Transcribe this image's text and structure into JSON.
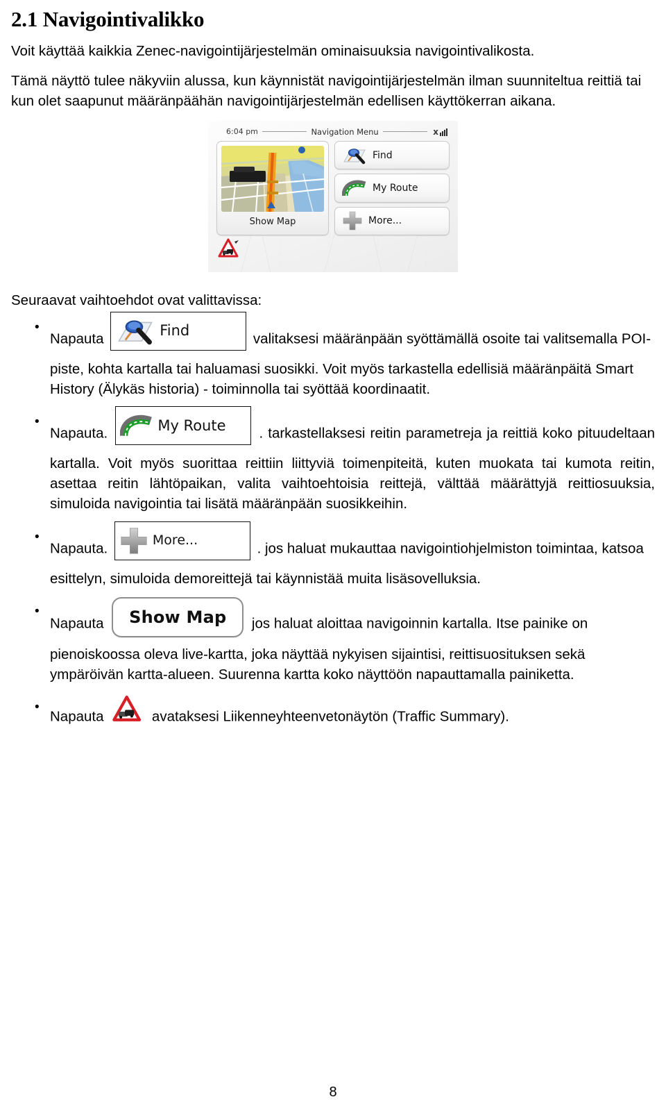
{
  "document": {
    "language": "fi",
    "page_number": "8"
  },
  "section": {
    "number": "2.1",
    "title": "2.1 Navigointivalikko",
    "intro_paragraph_1": "Voit käyttää kaikkia Zenec-navigointijärjestelmän ominaisuuksia navigointivalikosta.",
    "intro_paragraph_2": "Tämä näyttö tulee näkyviin alussa, kun käynnistät navigointijärjestelmän ilman suunniteltua reittiä tai kun olet saapunut määränpäähän navigointijärjestelmän edellisen käyttökerran aikana.",
    "options_lead_in": "Seuraavat vaihtoehdot ovat valittavissa:"
  },
  "device_screenshot": {
    "status_bar": {
      "time": "6:04 pm",
      "title": "Navigation Menu",
      "gps_icon": "gps-no-signal-icon"
    },
    "tiles": {
      "show_map": {
        "label": "Show Map",
        "icon": "map-thumbnail-icon"
      },
      "find": {
        "label": "Find",
        "icon": "magnifier-on-map-icon"
      },
      "my_route": {
        "label": "My Route",
        "icon": "curved-road-icon"
      },
      "more": {
        "label": "More...",
        "icon": "plus-icon"
      }
    },
    "traffic_badge": {
      "icon": "traffic-warning-triangle-icon"
    }
  },
  "bullets": [
    {
      "id": "find",
      "lead": "Napauta",
      "button_label": "Find",
      "button_icon": "magnifier-on-map-icon",
      "text": "valitaksesi määränpään syöttämällä osoite tai valitsemalla POI-piste, kohta kartalla tai haluamasi suosikki. Voit myös tarkastella edellisiä määränpäitä Smart History (Älykäs historia) - toiminnolla tai syöttää koordinaatit."
    },
    {
      "id": "my-route",
      "lead": "Napauta.",
      "button_label": "My Route",
      "button_icon": "curved-road-icon",
      "text": ". tarkastellaksesi reitin parametreja ja reittiä koko pituudeltaan kartalla. Voit myös suorittaa reittiin liittyviä toimenpiteitä, kuten muokata tai kumota reitin, asettaa reitin lähtöpaikan, valita vaihtoehtoisia reittejä, välttää määrättyjä reittiosuuksia, simuloida navigointia tai lisätä määränpään suosikkeihin."
    },
    {
      "id": "more",
      "lead": "Napauta.",
      "button_label": "More...",
      "button_icon": "plus-icon",
      "text": ". jos haluat mukauttaa navigointiohjelmiston toimintaa, katsoa esittelyn, simuloida demoreittejä tai käynnistää muita lisäsovelluksia."
    },
    {
      "id": "show-map",
      "lead": "Napauta",
      "button_label": "Show Map",
      "button_icon": "",
      "text": "jos haluat aloittaa navigoinnin kartalla. Itse painike on pienoiskoossa oleva live-kartta, joka näyttää nykyisen sijaintisi, reittisuosituksen sekä ympäröivän kartta-alueen. Suurenna kartta koko näyttöön napauttamalla painiketta."
    },
    {
      "id": "traffic",
      "lead": "Napauta",
      "button_label": "",
      "button_icon": "traffic-warning-triangle-icon",
      "text": "avataksesi Liikenneyhteenvetonäytön (Traffic Summary)."
    }
  ],
  "colors": {
    "text": "#000000",
    "background": "#ffffff",
    "route_green": "#1f9c2b",
    "road_grey": "#6e6e6e",
    "warning_red": "#d81f26",
    "map_water": "#8fbce0",
    "map_land": "#e8e0bc",
    "map_road": "#f0a020",
    "chip_border": "#111111"
  }
}
